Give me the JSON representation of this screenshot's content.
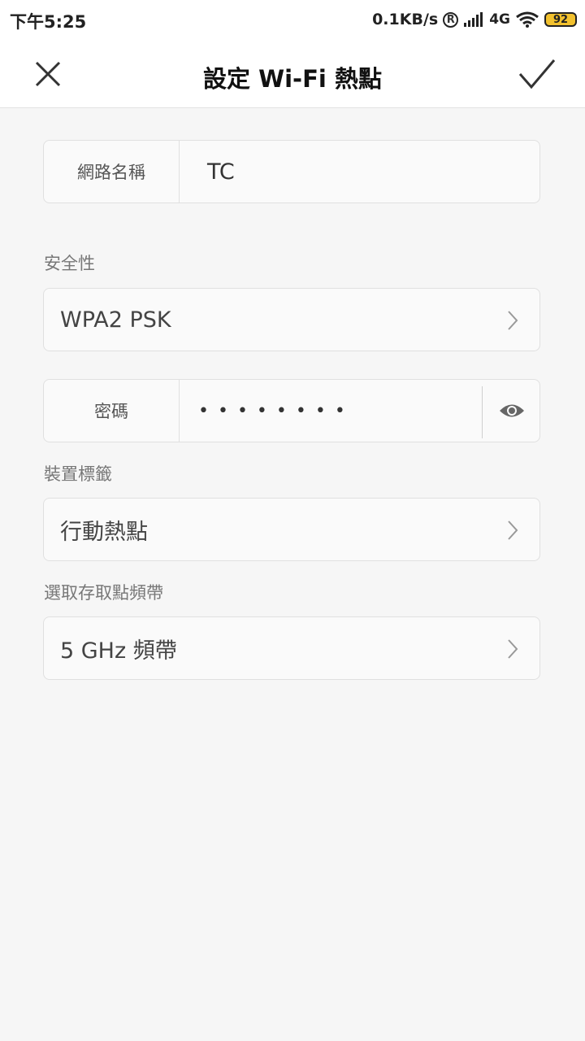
{
  "status_bar": {
    "time": "下午5:25",
    "speed": "0.1KB/s",
    "roaming": "R",
    "network": "4G",
    "battery": "92"
  },
  "header": {
    "title": "設定 Wi-Fi 熱點",
    "close_icon": "close-icon",
    "confirm_icon": "check-icon"
  },
  "network_name": {
    "label": "網路名稱",
    "value": "TC"
  },
  "security": {
    "label": "安全性",
    "value": "WPA2 PSK"
  },
  "password": {
    "label": "密碼",
    "masked_value": "••••••••"
  },
  "device_tag": {
    "label": "裝置標籤",
    "value": "行動熱點"
  },
  "band": {
    "label": "選取存取點頻帶",
    "value": "5 GHz 頻帶"
  },
  "colors": {
    "accent_battery": "#f2c12e",
    "background": "#f6f6f6"
  }
}
